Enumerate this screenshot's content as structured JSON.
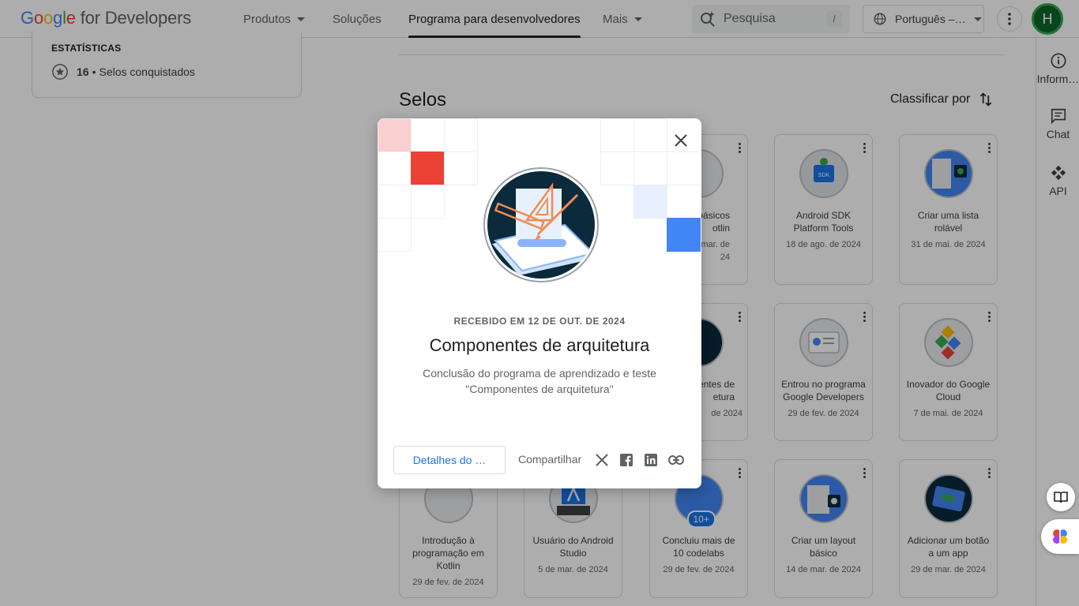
{
  "header": {
    "logo_google": "Google",
    "logo_rest": " for Developers",
    "nav": [
      "Produtos",
      "Soluções",
      "Programa para desenvolvedores",
      "Mais"
    ],
    "search_placeholder": "Pesquisa",
    "search_shortcut": "/",
    "language": "Português –…",
    "avatar_initial": "H"
  },
  "rail": {
    "info_label": "Inform…",
    "chat_label": "Chat",
    "api_label": "API"
  },
  "stats": {
    "title": "ESTATÍSTICAS",
    "count": "16",
    "separator": "•",
    "label": "Selos conquistados"
  },
  "badges_section": {
    "title": "Selos",
    "sort_label": "Classificar por"
  },
  "badges": [
    {
      "name": "s básicos\notlin",
      "date": "mar. de\n24"
    },
    {
      "name": "Android SDK Platform Tools",
      "date": "18 de ago. de 2024"
    },
    {
      "name": "Criar uma lista rolável",
      "date": "31 de mai. de 2024"
    },
    {
      "name": "entes de\netura",
      "date": "de 2024"
    },
    {
      "name": "Entrou no programa Google Developers",
      "date": "29 de fev. de 2024"
    },
    {
      "name": "Inovador do Google Cloud",
      "date": "7 de mai. de 2024"
    },
    {
      "name": "Introdução à programação em Kotlin",
      "date": "29 de fev. de 2024"
    },
    {
      "name": "Usuário do Android Studio",
      "date": "5 de mar. de 2024"
    },
    {
      "name": "Concluiu mais de 10 codelabs",
      "date": "29 de fev. de 2024",
      "tag": "10+"
    },
    {
      "name": "Criar um layout básico",
      "date": "14 de mar. de 2024"
    },
    {
      "name": "Adicionar um botão a um app",
      "date": "29 de mar. de 2024"
    }
  ],
  "modal": {
    "received": "RECEBIDO EM 12 DE OUT. DE 2024",
    "title": "Componentes de arquitetura",
    "description": "Conclusão do programa de aprendizado e teste \"Componentes de arquitetura\"",
    "details_button": "Detalhes do …",
    "share_label": "Compartilhar"
  },
  "colors": {
    "accent": "#1a73e8",
    "tile_red": "#ea4335",
    "tile_pink": "#f8d0cf",
    "tile_blue": "#4285f4",
    "tile_lightblue": "#e8f0fe",
    "badge_bg": "#0b2a3c",
    "avatar_bg": "#0d652d"
  },
  "icons": [
    "search-spark-icon",
    "globe-icon",
    "more-vert-icon",
    "info-icon",
    "chat-icon",
    "api-icon",
    "star-icon",
    "sort-icon",
    "close-icon",
    "x-icon",
    "facebook-icon",
    "linkedin-icon",
    "link-icon",
    "book-icon",
    "brain-icon"
  ]
}
